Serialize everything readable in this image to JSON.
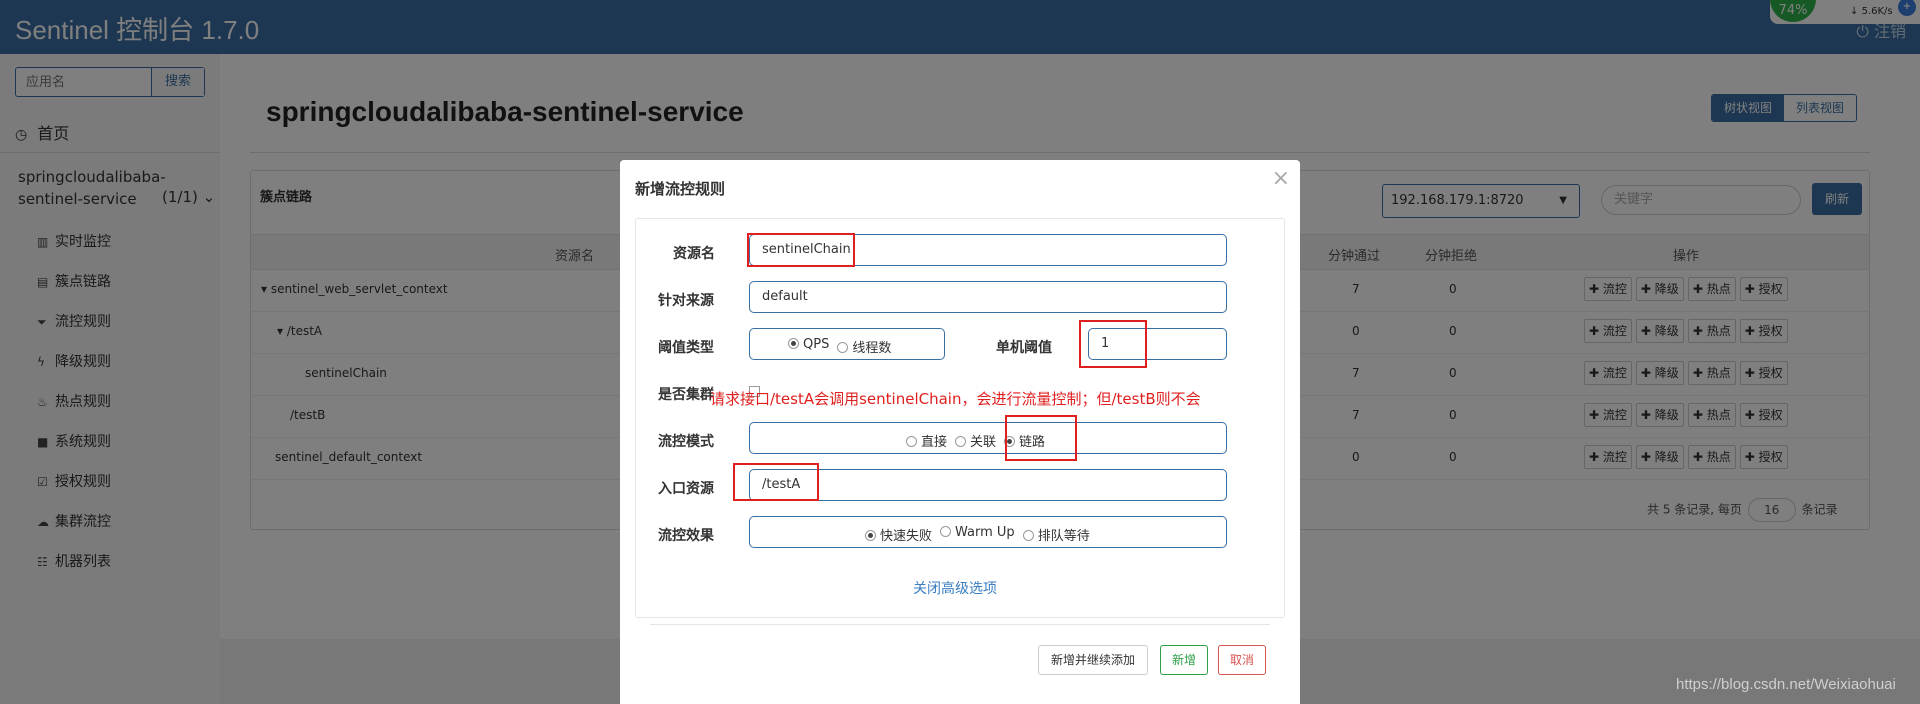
{
  "header": {
    "brand": "Sentinel 控制台 1.7.0",
    "logout": "注销"
  },
  "net_widget": {
    "cpu": "74%",
    "speed": "5.6K/s",
    "plus": "+"
  },
  "sidebar": {
    "search_placeholder": "应用名",
    "search_button": "搜索",
    "home": "首页",
    "app_name": "springcloudalibaba-sentinel-service",
    "app_count": "(1/1)",
    "items": [
      {
        "label": "实时监控",
        "icon": "bar-chart-icon"
      },
      {
        "label": "簇点链路",
        "icon": "list-icon"
      },
      {
        "label": "流控规则",
        "icon": "filter-icon"
      },
      {
        "label": "降级规则",
        "icon": "flash-icon"
      },
      {
        "label": "热点规则",
        "icon": "fire-icon"
      },
      {
        "label": "系统规则",
        "icon": "lock-icon"
      },
      {
        "label": "授权规则",
        "icon": "check-icon"
      },
      {
        "label": "集群流控",
        "icon": "cloud-icon"
      },
      {
        "label": "机器列表",
        "icon": "th-list-icon"
      }
    ]
  },
  "main": {
    "title": "springcloudalibaba-sentinel-service",
    "view_tree": "树状视图",
    "view_list": "列表视图",
    "panel_title": "簇点链路",
    "machine": "192.168.179.1:8720",
    "keyword_placeholder": "关键字",
    "refresh": "刷新",
    "columns": {
      "resource": "资源名",
      "pass_min": "分钟通过",
      "block_min": "分钟拒绝",
      "ops": "操作"
    },
    "rows": [
      {
        "name": "▾ sentinel_web_servlet_context",
        "pass": "7",
        "block": "0"
      },
      {
        "name": "▾ /testA",
        "pass": "0",
        "block": "0"
      },
      {
        "name": "sentinelChain",
        "pass": "7",
        "block": "0"
      },
      {
        "name": "/testB",
        "pass": "7",
        "block": "0"
      },
      {
        "name": "sentinel_default_context",
        "pass": "0",
        "block": "0"
      }
    ],
    "op_buttons": [
      "流控",
      "降级",
      "热点",
      "授权"
    ],
    "pager": {
      "prefix": "共 5 条记录, 每页",
      "page_size": "16",
      "suffix": "条记录"
    }
  },
  "modal": {
    "title": "新增流控规则",
    "close": "×",
    "resource_label": "资源名",
    "resource_value": "sentinelChain",
    "origin_label": "针对来源",
    "origin_value": "default",
    "threshold_type_label": "阈值类型",
    "threshold_qps": "QPS",
    "threshold_threads": "线程数",
    "single_threshold_label": "单机阈值",
    "single_threshold_value": "1",
    "cluster_label": "是否集群",
    "mode_label": "流控模式",
    "mode_direct": "直接",
    "mode_relate": "关联",
    "mode_chain": "链路",
    "entry_label": "入口资源",
    "entry_value": "/testA",
    "effect_label": "流控效果",
    "effect_fast": "快速失败",
    "effect_warm": "Warm Up",
    "effect_queue": "排队等待",
    "close_advanced": "关闭高级选项",
    "btn_add_continue": "新增并继续添加",
    "btn_add": "新增",
    "btn_cancel": "取消"
  },
  "annotation": "请求接口/testA会调用sentinelChain，会进行流量控制；但/testB则不会",
  "watermark": "https://blog.csdn.net/Weixiaohuai",
  "colors": {
    "header": "#3a6fa4",
    "accent": "#3a6fa4",
    "annotation": "#e02020"
  }
}
